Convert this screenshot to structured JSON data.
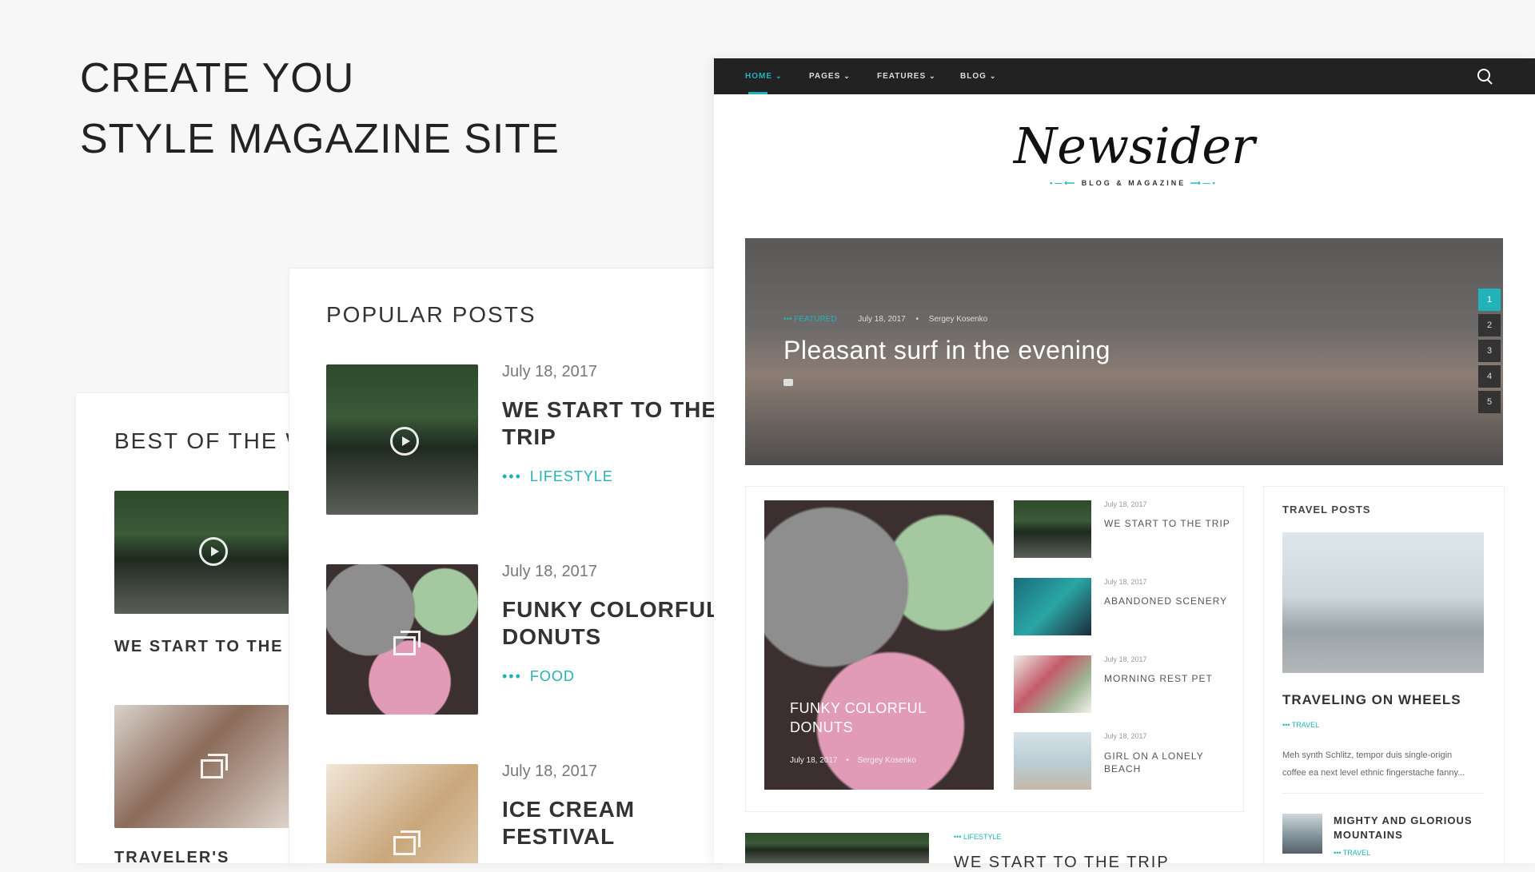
{
  "headline": {
    "line1": "CREATE YOU",
    "line2": "STYLE MAGAZINE SITE"
  },
  "best_of": {
    "title": "BEST OF THE WI",
    "items": [
      {
        "title": "WE START TO THE TR"
      },
      {
        "title": "TRAVELER'S"
      }
    ]
  },
  "popular": {
    "title": "POPULAR POSTS",
    "posts": [
      {
        "date": "July 18, 2017",
        "title_l1": "WE START TO THE",
        "title_l2": "TRIP",
        "category": "LIFESTYLE",
        "media": "play-icon"
      },
      {
        "date": "July 18, 2017",
        "title_l1": "FUNKY COLORFUL",
        "title_l2": "DONUTS",
        "category": "FOOD",
        "media": "gallery-icon"
      },
      {
        "date": "July 18, 2017",
        "title_l1": "ICE CREAM",
        "title_l2": "FESTIVAL",
        "category": "",
        "media": "gallery-icon"
      }
    ]
  },
  "site": {
    "nav": [
      {
        "label": "HOME",
        "active": true
      },
      {
        "label": "PAGES",
        "active": false
      },
      {
        "label": "FEATURES",
        "active": false
      },
      {
        "label": "BLOG",
        "active": false
      }
    ],
    "logo": {
      "name": "Newsider",
      "tagline": "BLOG & MAGAZINE"
    },
    "hero": {
      "category": "FEATURED",
      "date": "July 18, 2017",
      "author": "Sergey Kosenko",
      "title": "Pleasant surf in the evening",
      "pages": [
        "1",
        "2",
        "3",
        "4",
        "5"
      ]
    },
    "featured": {
      "title_l1": "FUNKY COLORFUL",
      "title_l2": "DONUTS",
      "date": "July 18, 2017",
      "author": "Sergey Kosenko"
    },
    "list": [
      {
        "date": "July 18, 2017",
        "title_l1": "WE START TO THE TRIP",
        "title_l2": ""
      },
      {
        "date": "July 18, 2017",
        "title_l1": "ABANDONED SCENERY",
        "title_l2": ""
      },
      {
        "date": "July 18, 2017",
        "title_l1": "MORNING REST PET",
        "title_l2": ""
      },
      {
        "date": "July 18, 2017",
        "title_l1": "GIRL ON A LONELY",
        "title_l2": "BEACH"
      }
    ],
    "travel": {
      "title": "TRAVEL POSTS",
      "main_title": "TRAVELING ON WHEELS",
      "main_category": "TRAVEL",
      "excerpt_l1": "Meh synth Schlitz, tempor duis single-origin",
      "excerpt_l2": "coffee ea next level ethnic fingerstache fanny...",
      "second_title_l1": "MIGHTY AND GLORIOUS",
      "second_title_l2": "MOUNTAINS",
      "second_category": "TRAVEL"
    },
    "bottom": {
      "category": "LIFESTYLE",
      "title": "WE START TO THE TRIP"
    }
  },
  "colors": {
    "accent": "#22b3b8",
    "nav_bg": "#222222"
  }
}
